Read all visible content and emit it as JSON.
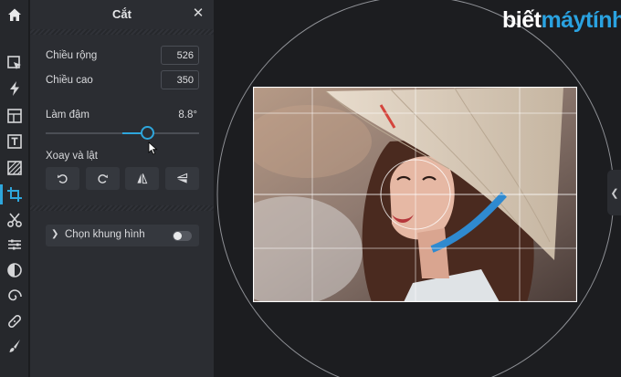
{
  "panel": {
    "title": "Cắt",
    "width_label": "Chiều rộng",
    "width_value": "526",
    "height_label": "Chiều cao",
    "height_value": "350",
    "straighten_label": "Làm đậm",
    "straighten_value": "8.8°",
    "straighten_degrees": 8.8,
    "rotate_flip_label": "Xoay và lật",
    "frame_label": "Chọn khung hình",
    "frame_toggle_on": false
  },
  "toolbar": {
    "icons": [
      "home-icon",
      "pointer-icon",
      "flash-icon",
      "layout-icon",
      "text-icon",
      "texture-icon",
      "crop-icon",
      "cut-icon",
      "adjust-icon",
      "contrast-icon",
      "spiral-icon",
      "bandage-icon",
      "brush-icon"
    ],
    "active": "crop-icon"
  },
  "watermark": {
    "part1": "biết",
    "part2": "máytính"
  },
  "colors": {
    "accent": "#2ea6dc",
    "panel_bg": "#2b2d32",
    "canvas_bg": "#1c1d20"
  }
}
